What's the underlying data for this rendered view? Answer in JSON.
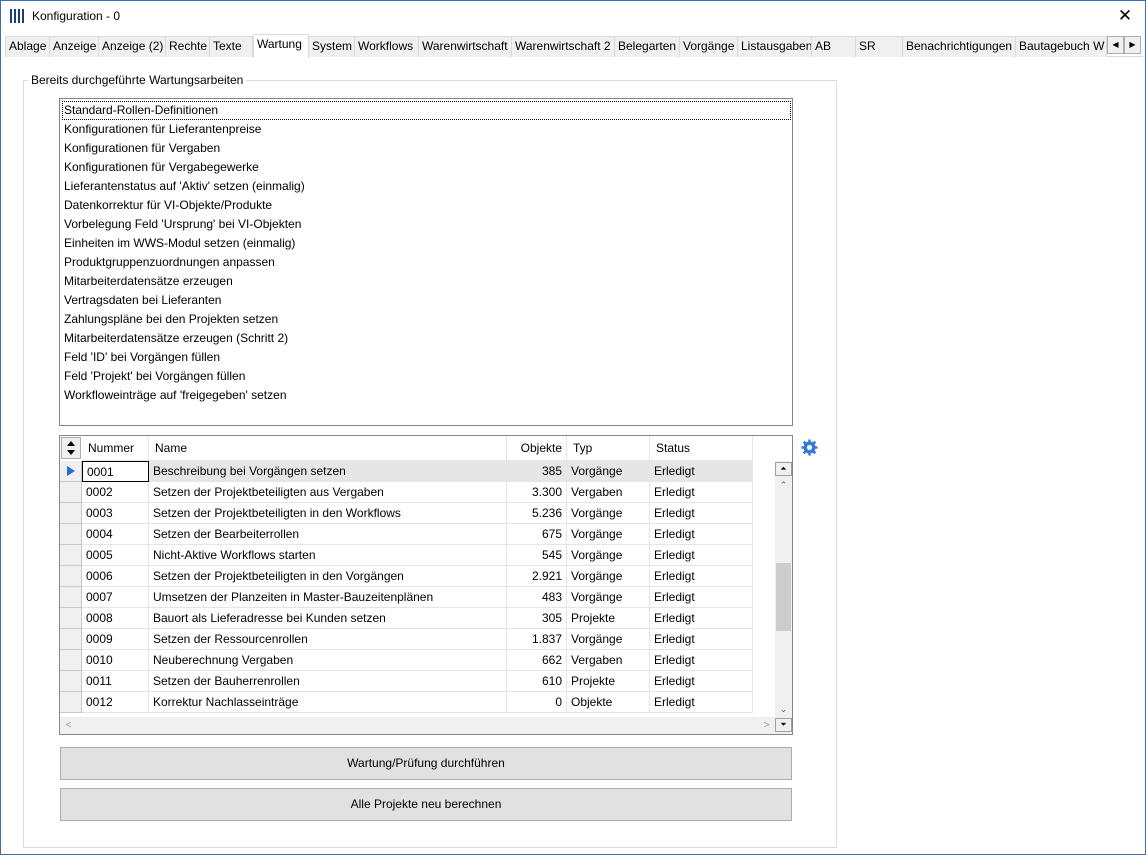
{
  "window": {
    "title": "Konfiguration - 0"
  },
  "tabs": [
    {
      "label": "Ablage"
    },
    {
      "label": "Anzeige"
    },
    {
      "label": "Anzeige (2)"
    },
    {
      "label": "Rechte"
    },
    {
      "label": "Texte"
    },
    {
      "label": "Wartung",
      "active": true
    },
    {
      "label": "System"
    },
    {
      "label": "Workflows"
    },
    {
      "label": "Warenwirtschaft"
    },
    {
      "label": "Warenwirtschaft 2"
    },
    {
      "label": "Belegarten"
    },
    {
      "label": "Vorgänge"
    },
    {
      "label": "Listausgaben"
    },
    {
      "label": "AB"
    },
    {
      "label": "SR"
    },
    {
      "label": "Benachrichtigungen"
    },
    {
      "label": "Bautagebuch W"
    }
  ],
  "group": {
    "label": "Bereits durchgeführte Wartungsarbeiten"
  },
  "list_items": [
    "Standard-Rollen-Definitionen",
    "Konfigurationen für Lieferantenpreise",
    "Konfigurationen für Vergaben",
    "Konfigurationen für Vergabegewerke",
    "Lieferantenstatus auf 'Aktiv' setzen (einmalig)",
    "Datenkorrektur für VI-Objekte/Produkte",
    "Vorbelegung Feld 'Ursprung' bei VI-Objekten",
    "Einheiten im WWS-Modul setzen (einmalig)",
    "Produktgruppenzuordnungen anpassen",
    "Mitarbeiterdatensätze erzeugen",
    "Vertragsdaten bei Lieferanten",
    "Zahlungspläne bei den Projekten setzen",
    "Mitarbeiterdatensätze erzeugen (Schritt 2)",
    "Feld 'ID' bei Vorgängen füllen",
    "Feld 'Projekt' bei Vorgängen füllen",
    "Workfloweinträge auf 'freigegeben' setzen"
  ],
  "grid": {
    "columns": {
      "nummer": "Nummer",
      "name": "Name",
      "objekte": "Objekte",
      "typ": "Typ",
      "status": "Status"
    },
    "rows": [
      {
        "nummer": "0001",
        "name": "Beschreibung bei Vorgängen setzen",
        "objekte": "385",
        "typ": "Vorgänge",
        "status": "Erledigt"
      },
      {
        "nummer": "0002",
        "name": "Setzen der Projektbeteiligten aus Vergaben",
        "objekte": "3.300",
        "typ": "Vergaben",
        "status": "Erledigt"
      },
      {
        "nummer": "0003",
        "name": "Setzen der Projektbeteiligten in den Workflows",
        "objekte": "5.236",
        "typ": "Vorgänge",
        "status": "Erledigt"
      },
      {
        "nummer": "0004",
        "name": "Setzen der Bearbeiterrollen",
        "objekte": "675",
        "typ": "Vorgänge",
        "status": "Erledigt"
      },
      {
        "nummer": "0005",
        "name": "Nicht-Aktive Workflows starten",
        "objekte": "545",
        "typ": "Vorgänge",
        "status": "Erledigt"
      },
      {
        "nummer": "0006",
        "name": "Setzen der Projektbeteiligten in den Vorgängen",
        "objekte": "2.921",
        "typ": "Vorgänge",
        "status": "Erledigt"
      },
      {
        "nummer": "0007",
        "name": "Umsetzen der Planzeiten in Master-Bauzeitenplänen",
        "objekte": "483",
        "typ": "Vorgänge",
        "status": "Erledigt"
      },
      {
        "nummer": "0008",
        "name": "Bauort als Lieferadresse bei Kunden setzen",
        "objekte": "305",
        "typ": "Projekte",
        "status": "Erledigt"
      },
      {
        "nummer": "0009",
        "name": "Setzen der Ressourcenrollen",
        "objekte": "1.837",
        "typ": "Vorgänge",
        "status": "Erledigt"
      },
      {
        "nummer": "0010",
        "name": "Neuberechnung Vergaben",
        "objekte": "662",
        "typ": "Vergaben",
        "status": "Erledigt"
      },
      {
        "nummer": "0011",
        "name": "Setzen der Bauherrenrollen",
        "objekte": "610",
        "typ": "Projekte",
        "status": "Erledigt"
      },
      {
        "nummer": "0012",
        "name": "Korrektur Nachlasseinträge",
        "objekte": "0",
        "typ": "Objekte",
        "status": "Erledigt"
      }
    ]
  },
  "buttons": {
    "maintenance": "Wartung/Prüfung durchführen",
    "recalculate": "Alle Projekte neu berechnen"
  },
  "icons": {
    "close": "close-icon",
    "settings": "gear-icon",
    "row_indicator": "current-row-arrow-icon"
  },
  "colors": {
    "accent": "#1f6fd1",
    "window_border": "#3a6fb5",
    "selected_row": "#e6e6e6"
  }
}
